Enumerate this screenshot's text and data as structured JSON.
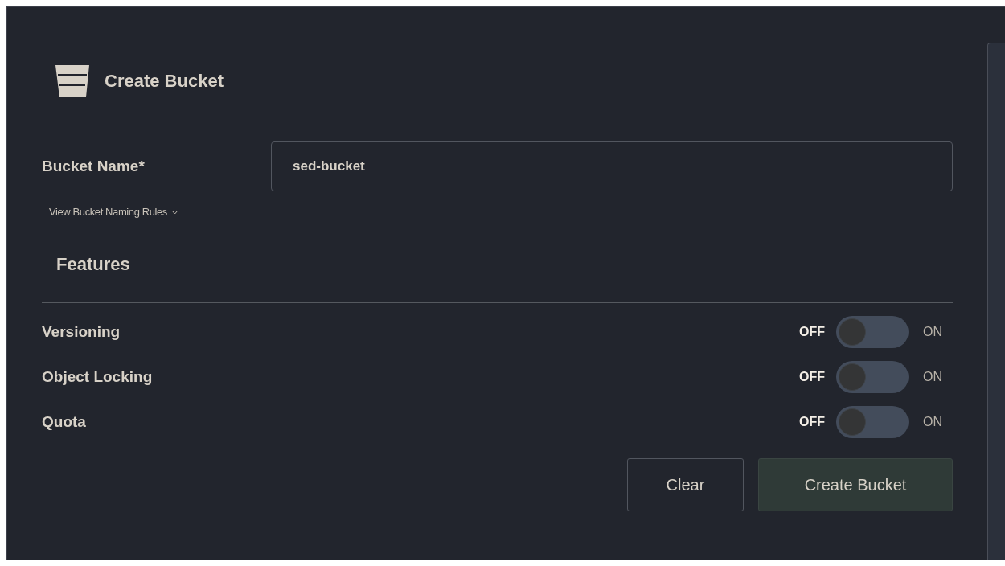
{
  "header": {
    "title": "Create Bucket"
  },
  "bucket_name": {
    "label": "Bucket Name*",
    "value": "sed-bucket"
  },
  "naming_rules_link": {
    "label": "View Bucket Naming Rules",
    "expanded": false
  },
  "features": {
    "heading": "Features",
    "toggles": [
      {
        "label": "Versioning",
        "off_label": "OFF",
        "on_label": "ON",
        "on": false
      },
      {
        "label": "Object Locking",
        "off_label": "OFF",
        "on_label": "ON",
        "on": false
      },
      {
        "label": "Quota",
        "off_label": "OFF",
        "on_label": "ON",
        "on": false
      }
    ]
  },
  "buttons": [
    {
      "label": "Clear",
      "kind": "secondary"
    },
    {
      "label": "Create Bucket",
      "kind": "primary"
    }
  ]
}
